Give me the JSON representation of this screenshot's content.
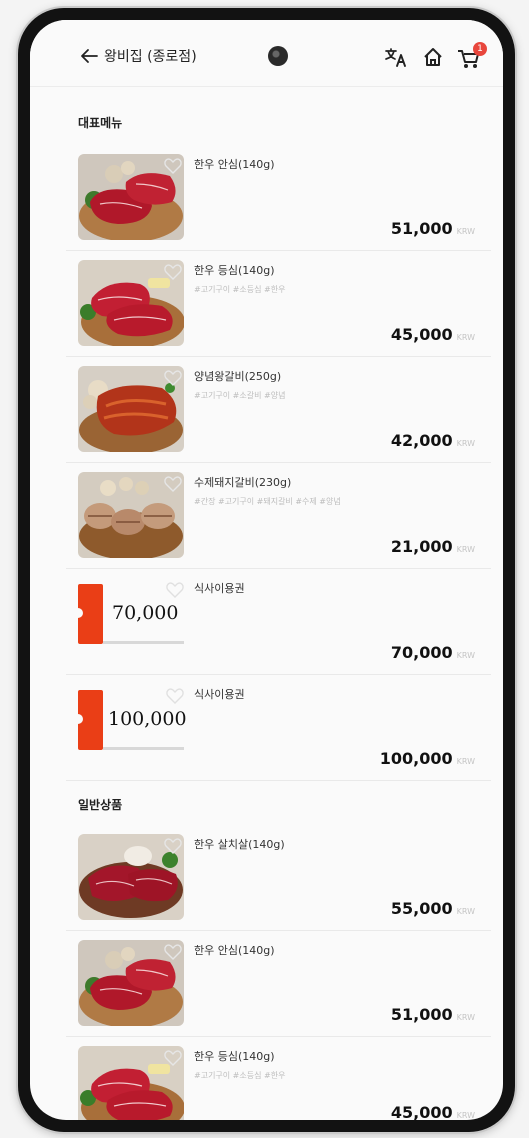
{
  "header": {
    "store_name": "왕비집 (종로점)",
    "cart_count": "1"
  },
  "sections": {
    "featured": {
      "title": "대표메뉴"
    },
    "general": {
      "title": "일반상품"
    }
  },
  "featured_items": [
    {
      "name": "한우 안심(140g)",
      "tags": "",
      "price": "51,000",
      "currency": "KRW"
    },
    {
      "name": "한우 등심(140g)",
      "tags": "#고기구이 #소등심 #한우",
      "price": "45,000",
      "currency": "KRW"
    },
    {
      "name": "양념왕갈비(250g)",
      "tags": "#고기구이 #소갈비 #양념",
      "price": "42,000",
      "currency": "KRW"
    },
    {
      "name": "수제돼지갈비(230g)",
      "tags": "#간장 #고기구이 #돼지갈비 #수제 #양념",
      "price": "21,000",
      "currency": "KRW"
    },
    {
      "name": "식사이용권",
      "tags": "",
      "voucher_amount": "70,000",
      "price": "70,000",
      "currency": "KRW"
    },
    {
      "name": "식사이용권",
      "tags": "",
      "voucher_amount": "100,000",
      "price": "100,000",
      "currency": "KRW"
    }
  ],
  "general_items": [
    {
      "name": "한우 살치살(140g)",
      "tags": "",
      "price": "55,000",
      "currency": "KRW"
    },
    {
      "name": "한우 안심(140g)",
      "tags": "",
      "price": "51,000",
      "currency": "KRW"
    },
    {
      "name": "한우 등심(140g)",
      "tags": "#고기구이 #소등심 #한우",
      "price": "45,000",
      "currency": "KRW"
    }
  ],
  "icons": {
    "back": "arrow-left-icon",
    "translate": "translate-icon",
    "home": "home-icon",
    "cart": "cart-icon",
    "favorite": "heart-outline-icon"
  },
  "colors": {
    "badge": "#e8463c",
    "voucher": "#ea3e16",
    "price_text": "#111111",
    "tag_text": "#bdbdbd"
  }
}
